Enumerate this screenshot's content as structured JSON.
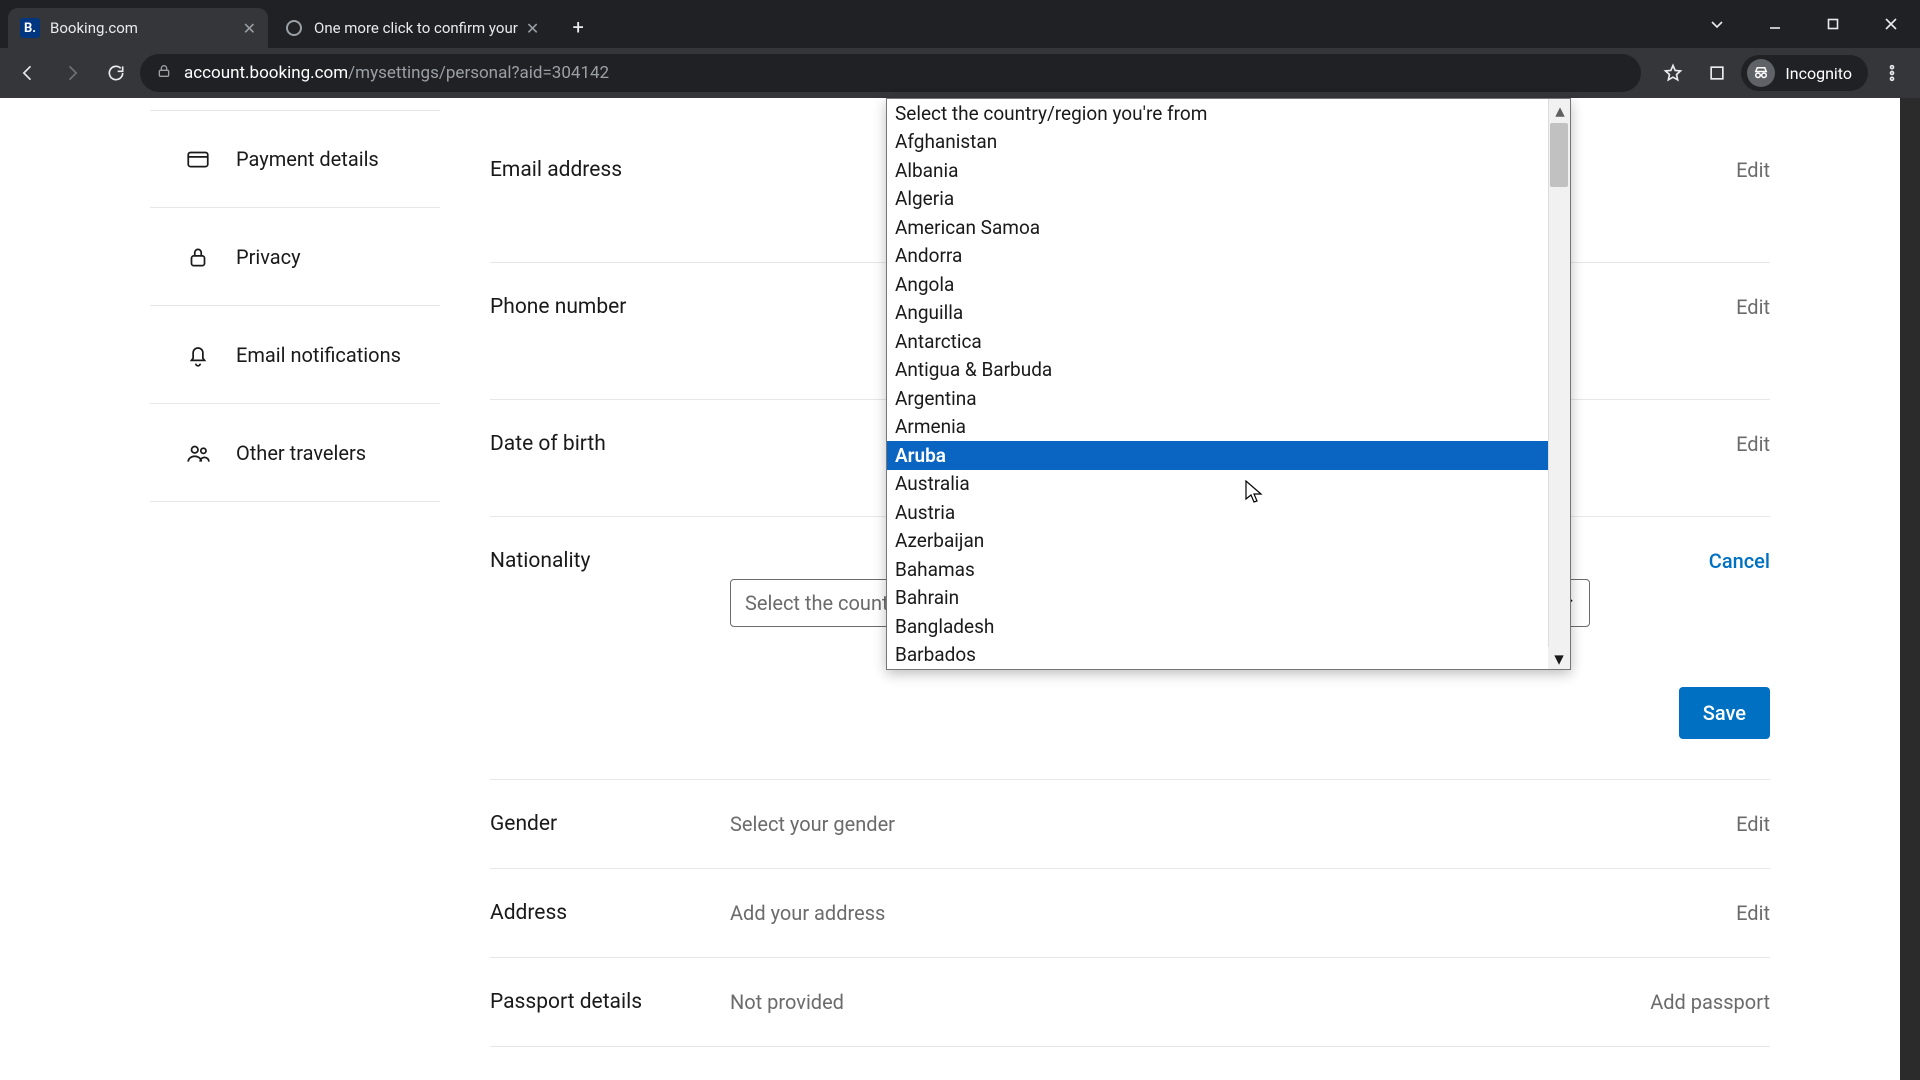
{
  "browser": {
    "tabs": [
      {
        "title": "Booking.com"
      },
      {
        "title": "One more click to confirm your"
      }
    ],
    "url_host": "account.booking.com",
    "url_path": "/mysettings/personal?aid=304142",
    "incognito_label": "Incognito"
  },
  "sidebar": {
    "items": [
      {
        "label": "Payment details"
      },
      {
        "label": "Privacy"
      },
      {
        "label": "Email notifications"
      },
      {
        "label": "Other travelers"
      }
    ]
  },
  "fields": {
    "email": {
      "label": "Email address",
      "action": "Edit"
    },
    "phone": {
      "label": "Phone number",
      "action": "Edit"
    },
    "dob": {
      "label": "Date of birth",
      "action": "Edit"
    },
    "nationality": {
      "label": "Nationality",
      "cancel": "Cancel",
      "placeholder": "Select the country/region you're from",
      "save": "Save"
    },
    "gender": {
      "label": "Gender",
      "value": "Select your gender",
      "action": "Edit"
    },
    "address": {
      "label": "Address",
      "value": "Add your address",
      "action": "Edit"
    },
    "passport": {
      "label": "Passport details",
      "value": "Not provided",
      "action": "Add passport"
    }
  },
  "dropdown": {
    "placeholder": "Select the country/region you're from",
    "highlighted": "Aruba",
    "options": [
      "Select the country/region you're from",
      "Afghanistan",
      "Albania",
      "Algeria",
      "American Samoa",
      "Andorra",
      "Angola",
      "Anguilla",
      "Antarctica",
      "Antigua & Barbuda",
      "Argentina",
      "Armenia",
      "Aruba",
      "Australia",
      "Austria",
      "Azerbaijan",
      "Bahamas",
      "Bahrain",
      "Bangladesh",
      "Barbados"
    ]
  }
}
